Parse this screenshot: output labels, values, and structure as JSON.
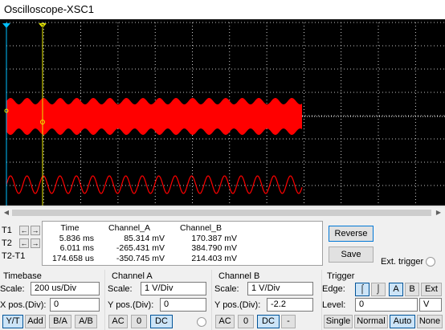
{
  "window": {
    "title": "Oscilloscope-XSC1"
  },
  "cursors": {
    "t1_label": "T1",
    "t2_label": "T2",
    "t2t1_label": "T2-T1",
    "cursor1_marker": "1",
    "cursor2_marker": "2"
  },
  "readout": {
    "headers": [
      "Time",
      "Channel_A",
      "Channel_B"
    ],
    "rows": [
      [
        "5.836 ms",
        "85.314 mV",
        "170.387 mV"
      ],
      [
        "6.011 ms",
        "-265.431 mV",
        "384.790 mV"
      ],
      [
        "174.658 us",
        "-350.745 mV",
        "214.403 mV"
      ]
    ]
  },
  "buttons": {
    "reverse": "Reverse",
    "save": "Save",
    "ext_trigger": "Ext. trigger"
  },
  "timebase": {
    "title": "Timebase",
    "scale_label": "Scale:",
    "scale_value": "200 us/Div",
    "xpos_label": "X pos.(Div):",
    "xpos_value": "0",
    "modes": [
      "Y/T",
      "Add",
      "B/A",
      "A/B"
    ]
  },
  "channel_a": {
    "title": "Channel A",
    "scale_label": "Scale:",
    "scale_value": "1  V/Div",
    "ypos_label": "Y pos.(Div):",
    "ypos_value": "0",
    "coupling": [
      "AC",
      "0",
      "DC"
    ]
  },
  "channel_b": {
    "title": "Channel B",
    "scale_label": "Scale:",
    "scale_value": "1  V/Div",
    "ypos_label": "Y pos.(Div):",
    "ypos_value": "-2.2",
    "coupling": [
      "AC",
      "0",
      "DC",
      "-"
    ]
  },
  "trigger": {
    "title": "Trigger",
    "edge_label": "Edge:",
    "level_label": "Level:",
    "level_value": "0",
    "level_unit": "V",
    "sources": [
      "A",
      "B",
      "Ext"
    ],
    "modes": [
      "Single",
      "Normal",
      "Auto",
      "None"
    ]
  },
  "colors": {
    "trace_a": "#ff0000",
    "screen_bg": "#000000",
    "selected_btn": "#cce4f7"
  }
}
